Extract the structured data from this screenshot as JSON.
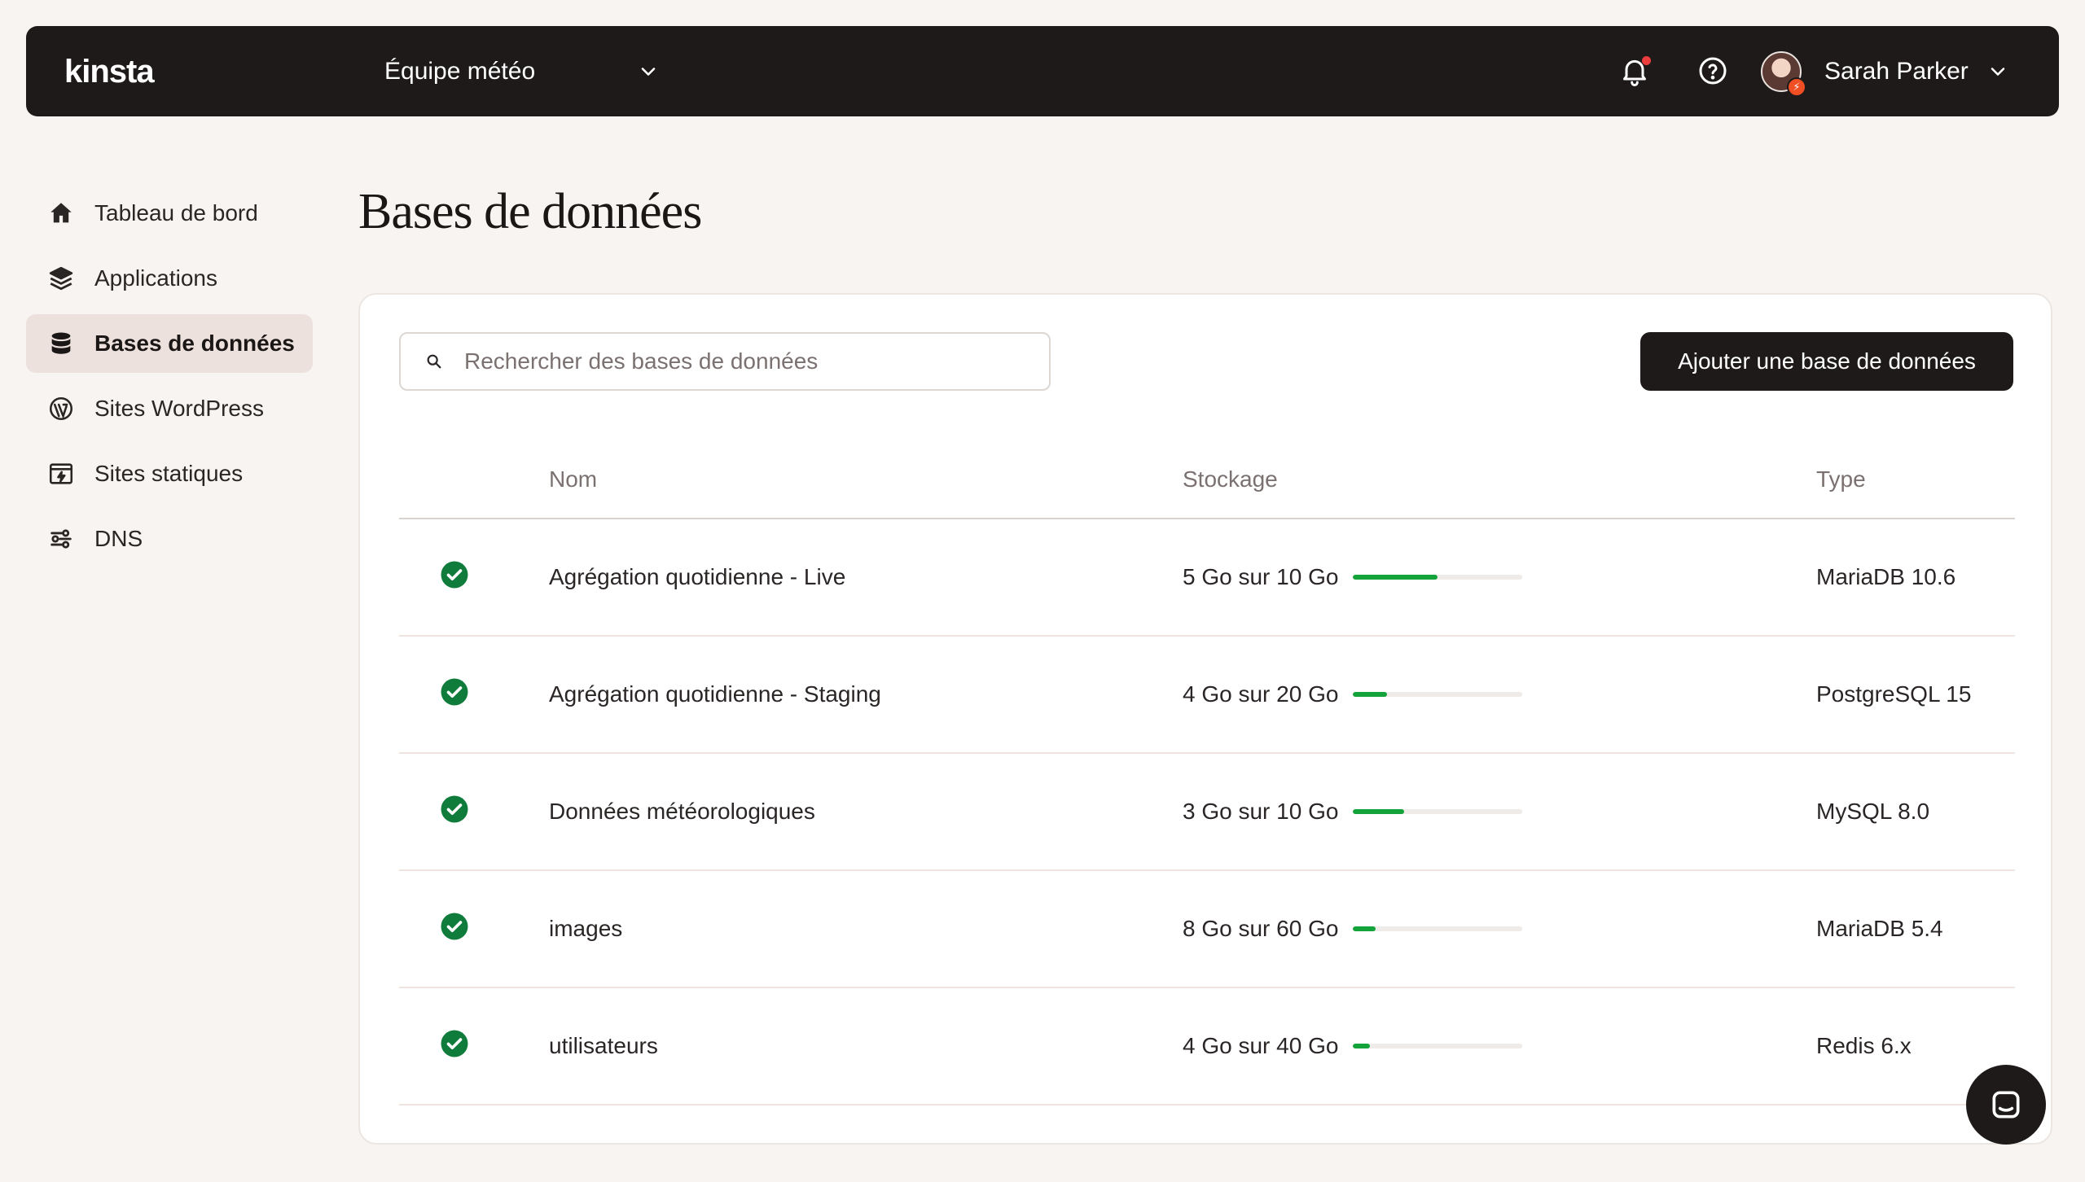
{
  "topbar": {
    "logo": "kinsta",
    "team_name": "Équipe météo",
    "user_name": "Sarah Parker",
    "icons": [
      "bell-icon",
      "help-icon",
      "chevron-down-icon"
    ],
    "notification_dot_color": "#ee3d3d"
  },
  "sidebar": {
    "items": [
      {
        "label": "Tableau de bord",
        "icon": "home-icon",
        "active": false
      },
      {
        "label": "Applications",
        "icon": "layers-icon",
        "active": false
      },
      {
        "label": "Bases de données",
        "icon": "database-icon",
        "active": true
      },
      {
        "label": "Sites WordPress",
        "icon": "wordpress-icon",
        "active": false
      },
      {
        "label": "Sites statiques",
        "icon": "static-site-icon",
        "active": false
      },
      {
        "label": "DNS",
        "icon": "dns-icon",
        "active": false
      }
    ]
  },
  "main": {
    "title": "Bases de données",
    "search_placeholder": "Rechercher des bases de données",
    "add_button": "Ajouter une base de données",
    "columns": {
      "name": "Nom",
      "storage": "Stockage",
      "type": "Type"
    },
    "rows": [
      {
        "name": "Agrégation quotidienne - Live",
        "storage": "5 Go sur 10 Go",
        "usage": 0.5,
        "type": "MariaDB 10.6",
        "status": "active"
      },
      {
        "name": "Agrégation quotidienne - Staging",
        "storage": "4 Go sur 20 Go",
        "usage": 0.2,
        "type": "PostgreSQL 15",
        "status": "active"
      },
      {
        "name": "Données météorologiques",
        "storage": "3 Go sur 10 Go",
        "usage": 0.3,
        "type": "MySQL 8.0",
        "status": "active"
      },
      {
        "name": "images",
        "storage": "8 Go sur 60 Go",
        "usage": 0.133,
        "type": "MariaDB 5.4",
        "status": "active"
      },
      {
        "name": "utilisateurs",
        "storage": "4 Go sur 40 Go",
        "usage": 0.1,
        "type": "Redis 6.x",
        "status": "active"
      }
    ]
  },
  "colors": {
    "accent": "#1e1a1a",
    "success": "#13a33a",
    "status_check": "#107c3b"
  }
}
